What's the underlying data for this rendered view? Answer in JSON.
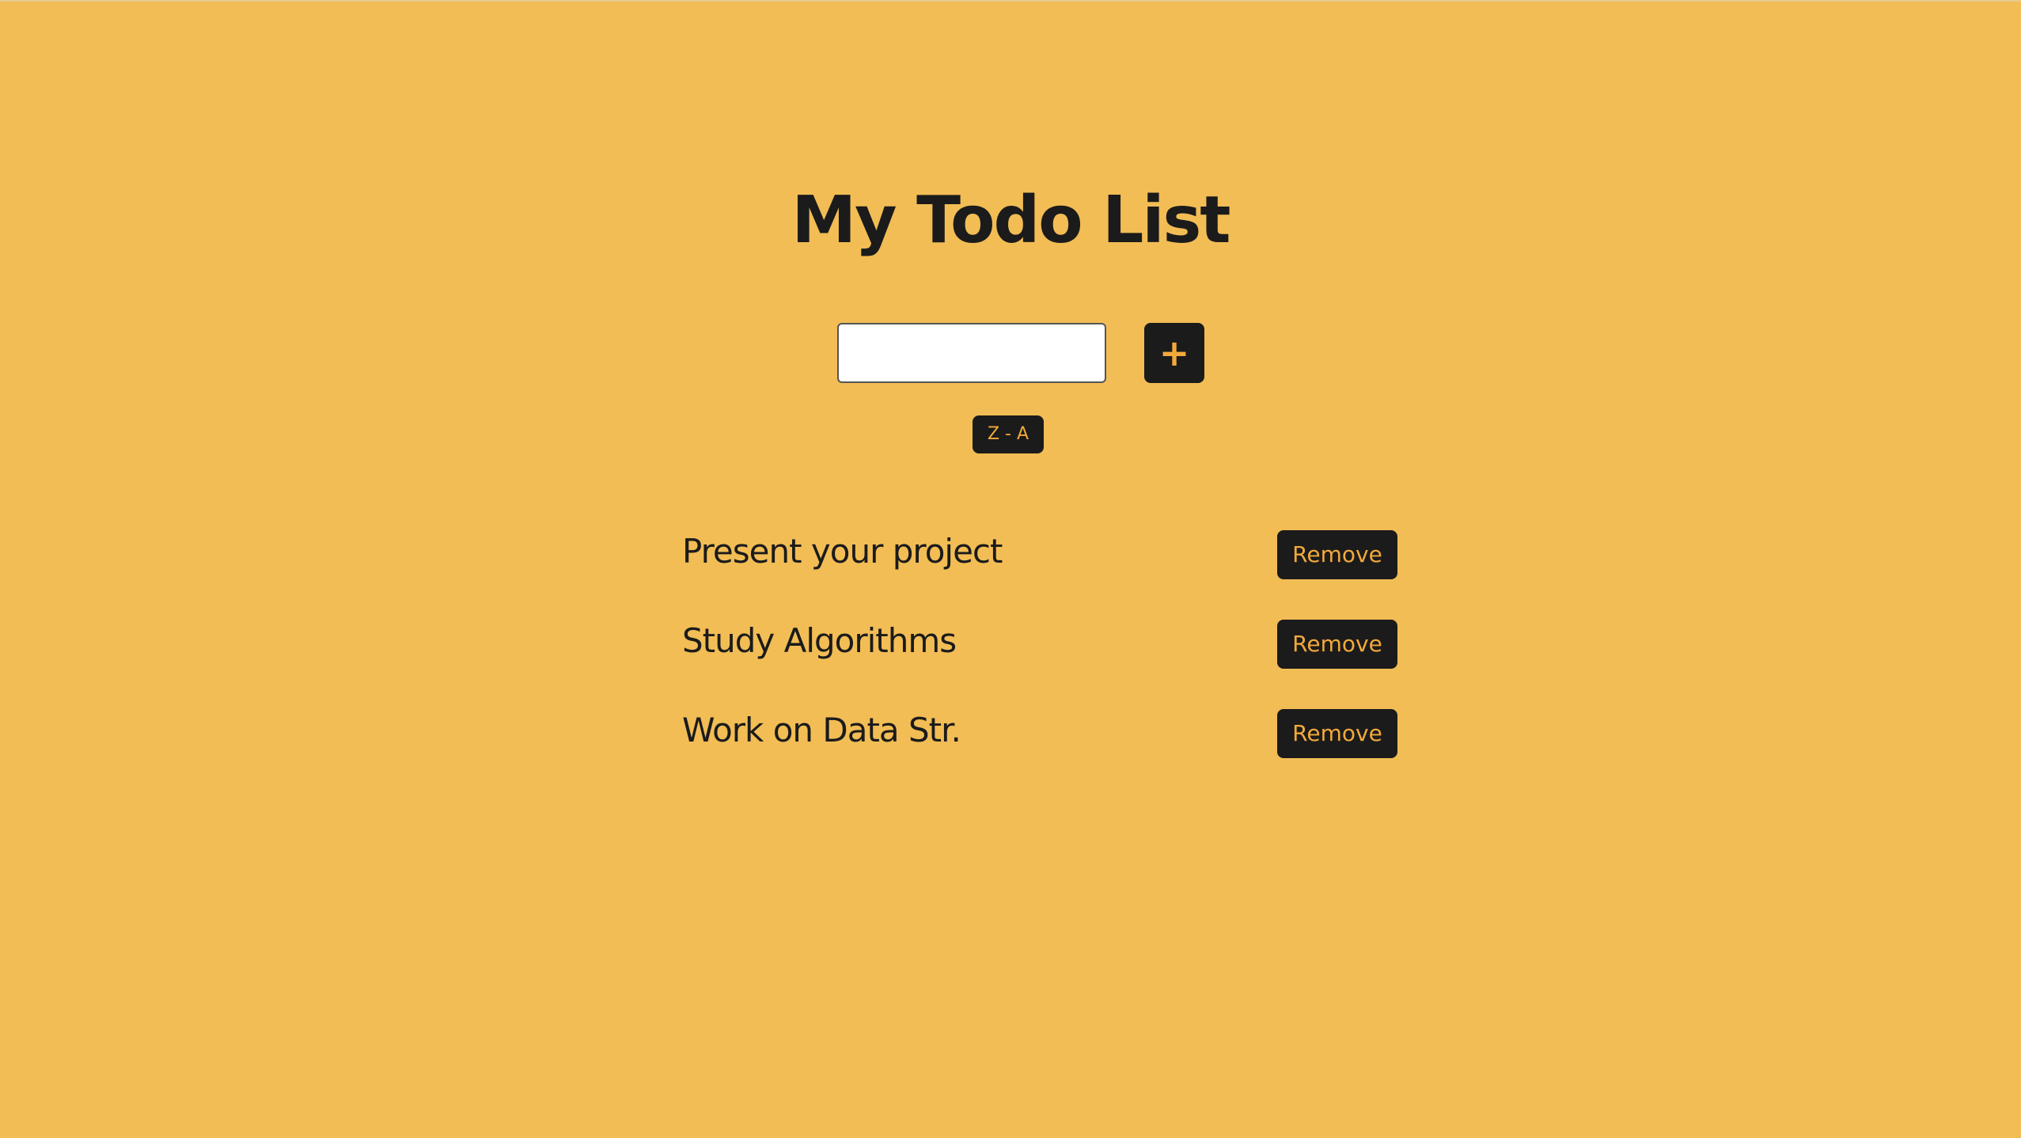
{
  "header": {
    "title": "My Todo List"
  },
  "form": {
    "input_value": "",
    "add_label": "+",
    "sort_label": "Z - A"
  },
  "todos": [
    {
      "text": "Present your project",
      "remove_label": "Remove"
    },
    {
      "text": "Study Algorithms",
      "remove_label": "Remove"
    },
    {
      "text": "Work on Data Str.",
      "remove_label": "Remove"
    }
  ],
  "colors": {
    "background": "#f2bd55",
    "button_bg": "#1b1b1b",
    "button_text": "#f2a93b",
    "text": "#1b1b1b"
  }
}
